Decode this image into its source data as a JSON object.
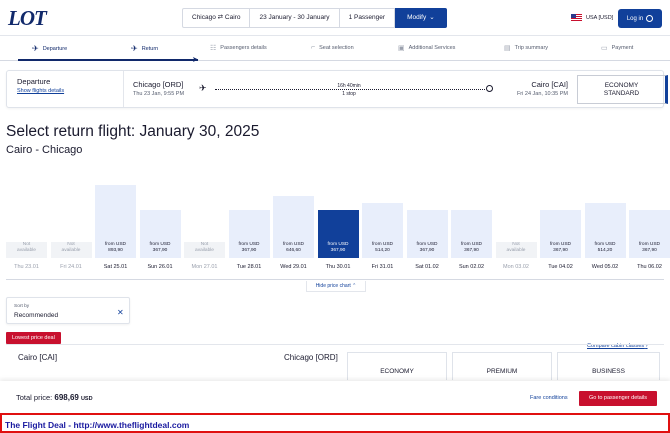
{
  "header": {
    "logo": "LOT",
    "route": "Chicago ⇄ Cairo",
    "dates": "23 January - 30 January",
    "passengers": "1 Passenger",
    "modify_label": "Modify",
    "currency": "USA [USD]",
    "login_label": "Log in"
  },
  "steps": [
    {
      "label": "Departure",
      "icon": "plane-departure-icon"
    },
    {
      "label": "Return",
      "icon": "plane-return-icon"
    },
    {
      "label": "Passengers details",
      "icon": "passengers-icon"
    },
    {
      "label": "Seat selection",
      "icon": "seat-icon"
    },
    {
      "label": "Additional Services",
      "icon": "services-icon"
    },
    {
      "label": "Trip summary",
      "icon": "summary-icon"
    },
    {
      "label": "Payment",
      "icon": "payment-icon"
    }
  ],
  "departure": {
    "title": "Departure",
    "details_link": "Show flights details",
    "origin_city": "Chicago [ORD]",
    "origin_time": "Thu 23 Jan, 9:55 PM",
    "duration": "16h 40min",
    "stops": "1 stop",
    "dest_city": "Cairo [CAI]",
    "dest_time": "Fri 24 Jan, 10:35 PM",
    "cabin_line1": "ECONOMY",
    "cabin_line2": "STANDARD"
  },
  "title": "Select return flight: January 30, 2025",
  "subtitle": "Cairo - Chicago",
  "price_chart": {
    "hide_label": "Hide price chart",
    "days": [
      {
        "day": "Thu 23.01",
        "available": false,
        "label1": "Not",
        "label2": "available",
        "level": 0.2
      },
      {
        "day": "Fri 24.01",
        "available": false,
        "label1": "Not",
        "label2": "available",
        "level": 0.2
      },
      {
        "day": "Sat 25.01",
        "available": true,
        "label1": "from USD",
        "label2": "893,90",
        "level": 0.94
      },
      {
        "day": "Sun 26.01",
        "available": true,
        "label1": "from USD",
        "label2": "367,90",
        "level": 0.62
      },
      {
        "day": "Mon 27.01",
        "available": false,
        "label1": "Not",
        "label2": "available",
        "level": 0.2
      },
      {
        "day": "Tue 28.01",
        "available": true,
        "label1": "from USD",
        "label2": "367,90",
        "level": 0.62
      },
      {
        "day": "Wed 29.01",
        "available": true,
        "label1": "from USD",
        "label2": "646,60",
        "level": 0.8
      },
      {
        "day": "Thu 30.01",
        "available": true,
        "selected": true,
        "label1": "from USD",
        "label2": "367,90",
        "level": 0.62
      },
      {
        "day": "Fri 31.01",
        "available": true,
        "label1": "from USD",
        "label2": "514,20",
        "level": 0.7
      },
      {
        "day": "Sat 01.02",
        "available": true,
        "label1": "from USD",
        "label2": "367,90",
        "level": 0.62
      },
      {
        "day": "Sun 02.02",
        "available": true,
        "label1": "from USD",
        "label2": "367,90",
        "level": 0.62
      },
      {
        "day": "Mon 03.02",
        "available": false,
        "label1": "Not",
        "label2": "available",
        "level": 0.2
      },
      {
        "day": "Tue 04.02",
        "available": true,
        "label1": "from USD",
        "label2": "367,90",
        "level": 0.62
      },
      {
        "day": "Wed 05.02",
        "available": true,
        "label1": "from USD",
        "label2": "514,20",
        "level": 0.7
      },
      {
        "day": "Thu 06.02",
        "available": true,
        "label1": "from USD",
        "label2": "367,90",
        "level": 0.62
      }
    ]
  },
  "sort": {
    "label": "Sort by",
    "value": "Recommended"
  },
  "results": {
    "badge": "Lowest price deal",
    "compare_link": "Compare cabin classes",
    "origin": "Cairo [CAI]",
    "dest": "Chicago [ORD]",
    "cabins": [
      "ECONOMY",
      "PREMIUM",
      "BUSINESS"
    ]
  },
  "footer": {
    "total_label": "Total price:",
    "total_value": "698,69",
    "total_currency": "USD",
    "fare_conditions": "Fare conditions",
    "go_button": "Go to passenger details"
  },
  "watermark": "The Flight Deal - http://www.theflightdeal.com",
  "colors": {
    "brand_blue": "#11409a",
    "navy": "#11296b",
    "red": "#c8102e"
  }
}
